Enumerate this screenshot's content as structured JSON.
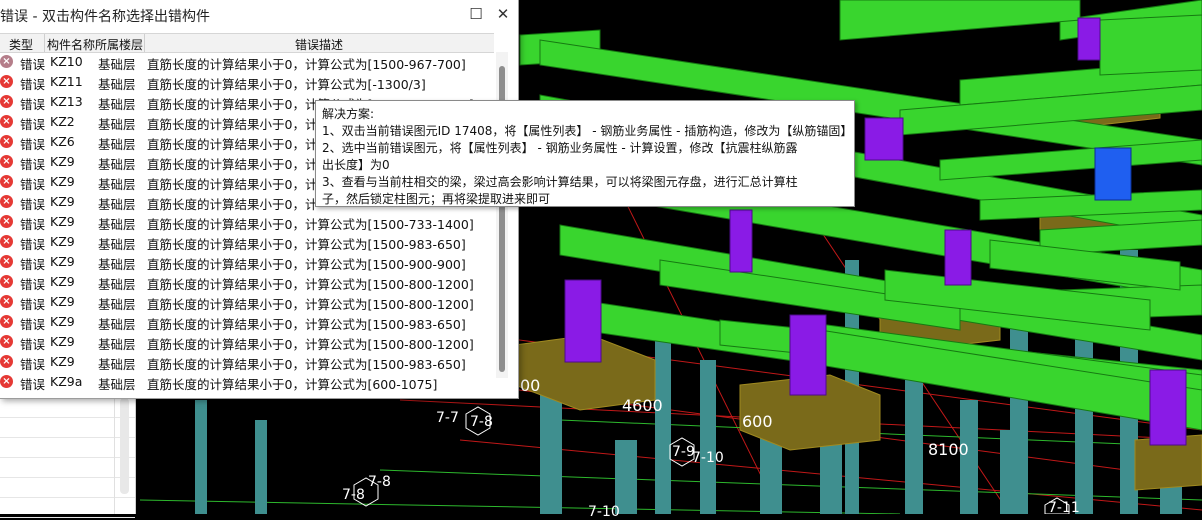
{
  "dialog": {
    "title": "错误 - 双击构件名称选择出错构件",
    "maximize_glyph": "☐",
    "close_glyph": "✕",
    "columns": [
      "类型",
      "构件名称",
      "所属楼层",
      "错误描述"
    ],
    "rows": [
      {
        "type": "错误",
        "name": "KZ10",
        "floor": "基础层",
        "desc": "直筋长度的计算结果小于0，计算公式为[1500-967-700]"
      },
      {
        "type": "错误",
        "name": "KZ11",
        "floor": "基础层",
        "desc": "直筋长度的计算结果小于0，计算公式为[-1300/3]"
      },
      {
        "type": "错误",
        "name": "KZ13",
        "floor": "基础层",
        "desc": "直筋长度的计算结果小于0，计算公式为[1500-837-1300]"
      },
      {
        "type": "错误",
        "name": "KZ2",
        "floor": "基础层",
        "desc": "直筋长度的计算结果小于0，计"
      },
      {
        "type": "错误",
        "name": "KZ6",
        "floor": "基础层",
        "desc": "直筋长度的计算结果小于0，计"
      },
      {
        "type": "错误",
        "name": "KZ9",
        "floor": "基础层",
        "desc": "直筋长度的计算结果小于0，计"
      },
      {
        "type": "错误",
        "name": "KZ9",
        "floor": "基础层",
        "desc": "直筋长度的计算结果小于0，计"
      },
      {
        "type": "错误",
        "name": "KZ9",
        "floor": "基础层",
        "desc": "直筋长度的计算结果小于0，计"
      },
      {
        "type": "错误",
        "name": "KZ9",
        "floor": "基础层",
        "desc": "直筋长度的计算结果小于0，计算公式为[1500-733-1400]"
      },
      {
        "type": "错误",
        "name": "KZ9",
        "floor": "基础层",
        "desc": "直筋长度的计算结果小于0，计算公式为[1500-983-650]"
      },
      {
        "type": "错误",
        "name": "KZ9",
        "floor": "基础层",
        "desc": "直筋长度的计算结果小于0，计算公式为[1500-900-900]"
      },
      {
        "type": "错误",
        "name": "KZ9",
        "floor": "基础层",
        "desc": "直筋长度的计算结果小于0，计算公式为[1500-800-1200]"
      },
      {
        "type": "错误",
        "name": "KZ9",
        "floor": "基础层",
        "desc": "直筋长度的计算结果小于0，计算公式为[1500-800-1200]"
      },
      {
        "type": "错误",
        "name": "KZ9",
        "floor": "基础层",
        "desc": "直筋长度的计算结果小于0，计算公式为[1500-983-650]"
      },
      {
        "type": "错误",
        "name": "KZ9",
        "floor": "基础层",
        "desc": "直筋长度的计算结果小于0，计算公式为[1500-800-1200]"
      },
      {
        "type": "错误",
        "name": "KZ9",
        "floor": "基础层",
        "desc": "直筋长度的计算结果小于0，计算公式为[1500-983-650]"
      },
      {
        "type": "错误",
        "name": "KZ9a",
        "floor": "基础层",
        "desc": "直筋长度的计算结果小于0，计算公式为[600-1075]"
      }
    ]
  },
  "tooltip": {
    "lines": [
      "解决方案:",
      "1、双击当前错误图元ID 17408，将【属性列表】 - 钢筋业务属性 - 插筋构造，修改为【纵筋锚固】",
      "2、选中当前错误图元，将【属性列表】 - 钢筋业务属性 - 计算设置，修改【抗震柱纵筋露",
      "出长度】为0",
      "3、查看与当前柱相交的梁，梁过高会影响计算结果，可以将梁图元存盘，进行汇总计算柱",
      "子，然后锁定柱图元；再将梁提取进来即可"
    ]
  },
  "viewport": {
    "dimension_labels": [
      "00",
      "4600",
      "600",
      "8100"
    ],
    "axis_labels": [
      "7-7",
      "7-8",
      "7-9",
      "7-10",
      "7-8",
      "7-8",
      "7-10",
      "7-11"
    ]
  },
  "colors": {
    "beam": "#39d52e",
    "column": "#8a1be6",
    "selected_column": "#1f5ff0",
    "footing": "#7a6a1a",
    "pile": "#3f8f8f",
    "error_icon": "#e53935"
  }
}
